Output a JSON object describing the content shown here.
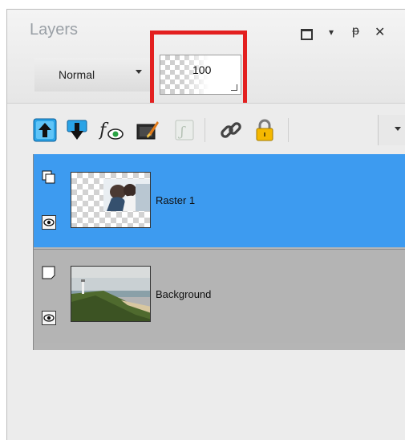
{
  "panel": {
    "title": "Layers",
    "window_controls": {
      "maximize": "□",
      "menu": "▾",
      "pin": "ᵽ",
      "close": "✕"
    }
  },
  "blend_mode": {
    "value": "Normal"
  },
  "opacity": {
    "value": "100"
  },
  "toolbar": {
    "icons": [
      "move-layer-up-icon",
      "move-layer-down-icon",
      "layer-effects-icon",
      "edit-mask-icon",
      "script-icon",
      "link-icon",
      "lock-icon",
      "more-dropdown-icon"
    ]
  },
  "layers": [
    {
      "name": "Raster 1",
      "selected": true,
      "visible": true,
      "type": "raster"
    },
    {
      "name": "Background",
      "selected": false,
      "visible": true,
      "type": "background"
    }
  ],
  "colors": {
    "selection": "#3d9bf0",
    "highlight_border": "#e32020",
    "panel_bg": "#ececec"
  }
}
